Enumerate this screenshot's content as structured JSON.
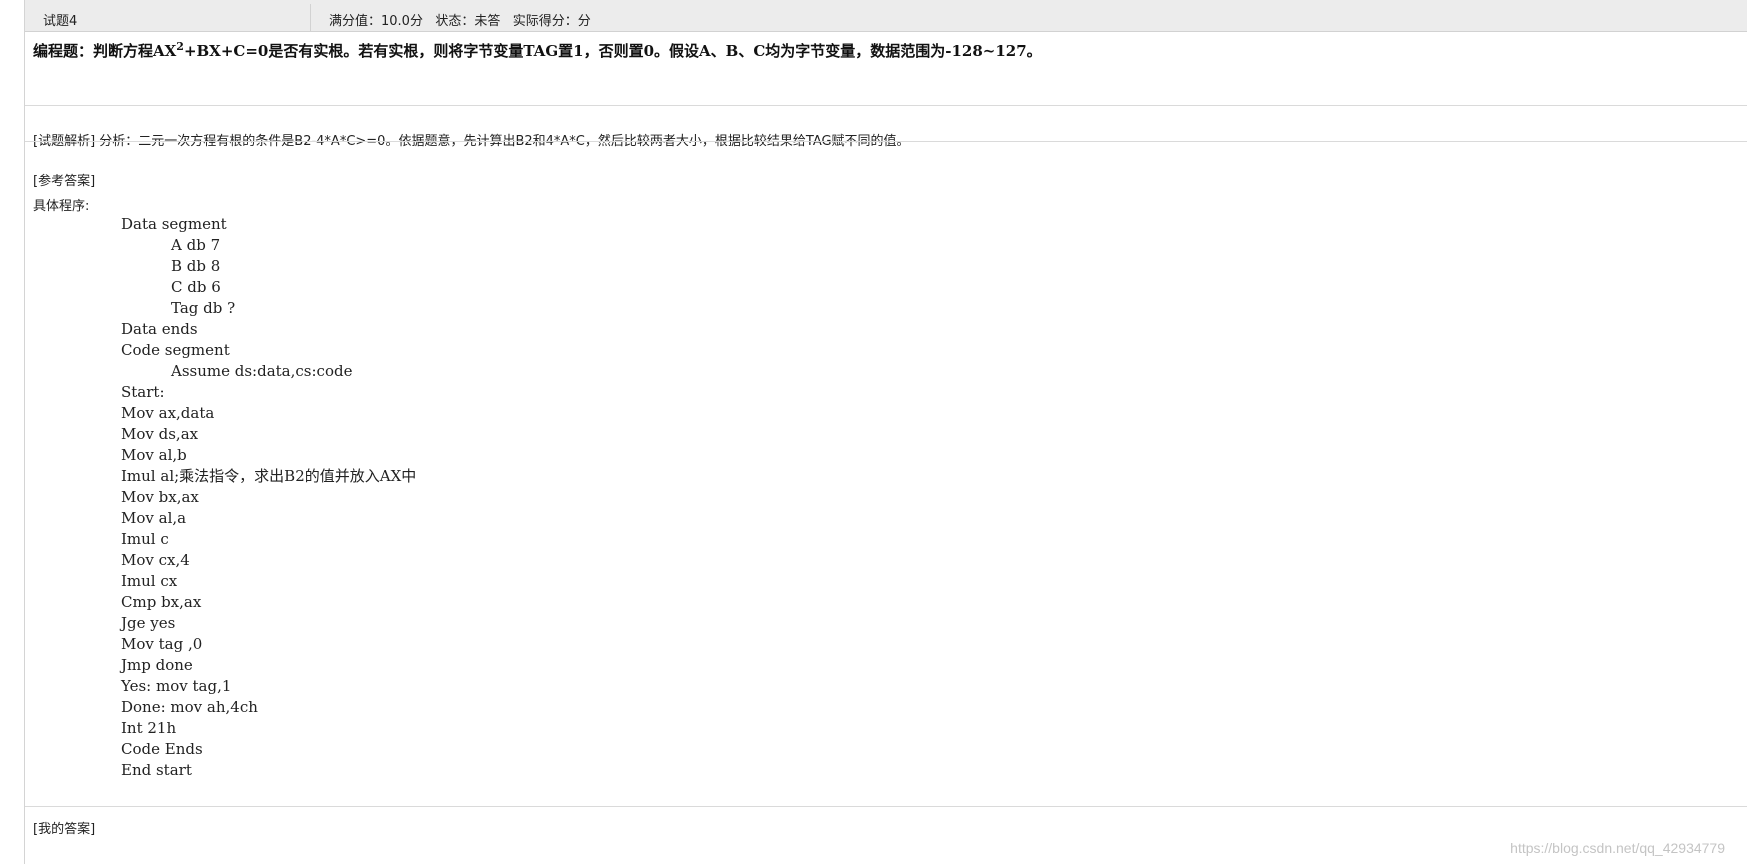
{
  "header": {
    "question_no": "试题4",
    "meta": "满分值：10.0分   状态：未答   实际得分：分"
  },
  "question": {
    "part1": "编程题：判断方程AX",
    "sup": "2",
    "part2": "+BX+C=0是否有实根。若有实根，则将字节变量TAG置1，否则置0。假设A、B、C均为字节变量，数据范围为-128~127。"
  },
  "analysis": "[试题解析] 分析：二元一次方程有根的条件是B2-4*A*C>=0。依据题意，先计算出B2和4*A*C，然后比较两者大小，根据比较结果给TAG赋不同的值。",
  "reference": {
    "title": "[参考答案]",
    "program_title": "具体程序:",
    "code_lines": [
      "Data segment",
      "A db 7",
      "B db 8",
      "C db 6",
      "Tag db ?",
      "Data ends",
      "Code segment",
      "Assume ds:data,cs:code",
      "Start:",
      "Mov ax,data",
      "Mov ds,ax",
      "Mov al,b",
      "Imul al;乘法指令，求出B2的值并放入AX中",
      "Mov bx,ax",
      "Mov al,a",
      "Imul c",
      "Mov cx,4",
      "Imul cx",
      "Cmp bx,ax",
      "Jge yes",
      "Mov tag ,0",
      "Jmp done",
      "Yes: mov tag,1",
      "Done: mov ah,4ch",
      "Int 21h",
      "Code Ends",
      "End start"
    ]
  },
  "my_answer": "[我的答案]",
  "watermark": "https://blog.csdn.net/qq_42934779"
}
